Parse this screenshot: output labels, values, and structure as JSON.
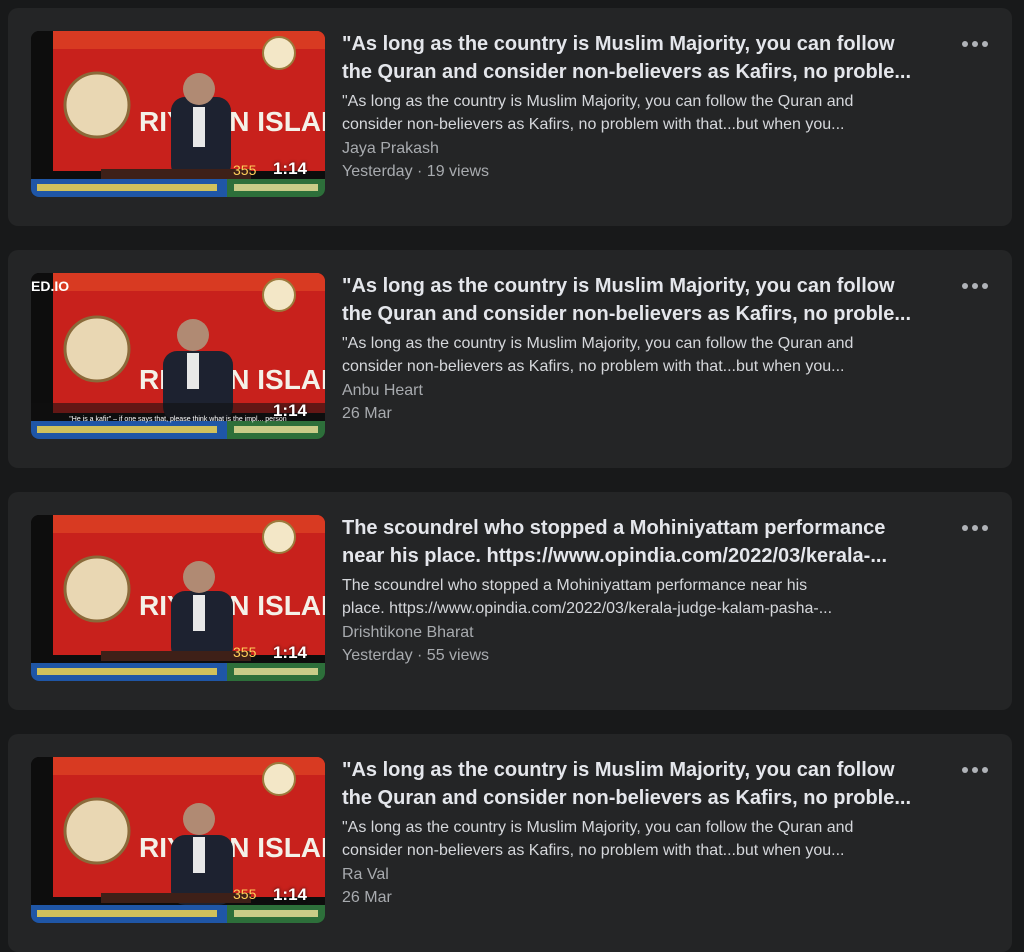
{
  "videos": [
    {
      "title_line1": "\"As long as the country is Muslim Majority, you can follow",
      "title_line2": "the Quran and consider non-believers as Kafirs, no proble...",
      "desc_line1": "\"As long as the country is Muslim Majority, you can follow the Quran and",
      "desc_line2": "consider non-believers as Kafirs, no problem with that...but when you...",
      "author": "Jaya Prakash",
      "meta": "Yesterday · 19 views",
      "duration": "1:14",
      "thumb_banner": "RIYADH  DAN ISLAHI",
      "thumb_number": "355"
    },
    {
      "title_line1": "\"As long as the country is Muslim Majority, you can follow",
      "title_line2": "the Quran and consider non-believers as Kafirs, no proble...",
      "desc_line1": "\"As long as the country is Muslim Majority, you can follow the Quran and",
      "desc_line2": "consider non-believers as Kafirs, no problem with that...but when you...",
      "author": "Anbu Heart",
      "meta": "26 Mar",
      "duration": "1:14",
      "thumb_banner": "RIYADH  DAN ISLAHI",
      "watermark": "ED.IO",
      "caption": "\"He is a kafir\" – if one says that, please think what is the impl... person"
    },
    {
      "title_line1": "The scoundrel who stopped a Mohiniyattam performance",
      "title_line2": "near his place. https://www.opindia.com/2022/03/kerala-...",
      "desc_line1": "The scoundrel who stopped a Mohiniyattam performance near his",
      "desc_line2": "place. https://www.opindia.com/2022/03/kerala-judge-kalam-pasha-...",
      "author": "Drishtikone Bharat",
      "meta": "Yesterday · 55 views",
      "duration": "1:14",
      "thumb_banner": "RIYADH  DAN ISLAHI",
      "thumb_number": "355"
    },
    {
      "title_line1": "\"As long as the country is Muslim Majority, you can follow",
      "title_line2": "the Quran and consider non-believers as Kafirs, no proble...",
      "desc_line1": "\"As long as the country is Muslim Majority, you can follow the Quran and",
      "desc_line2": "consider non-believers as Kafirs, no problem with that...but when you...",
      "author": "Ra Val",
      "meta": "26 Mar",
      "duration": "1:14",
      "thumb_banner": "RIYADH  DAN ISLAHI",
      "thumb_number": "355"
    }
  ],
  "icons": {
    "more": "more-horizontal-icon"
  },
  "colors": {
    "background": "#18191a",
    "card": "#242526",
    "banner_red": "#c8211c"
  }
}
